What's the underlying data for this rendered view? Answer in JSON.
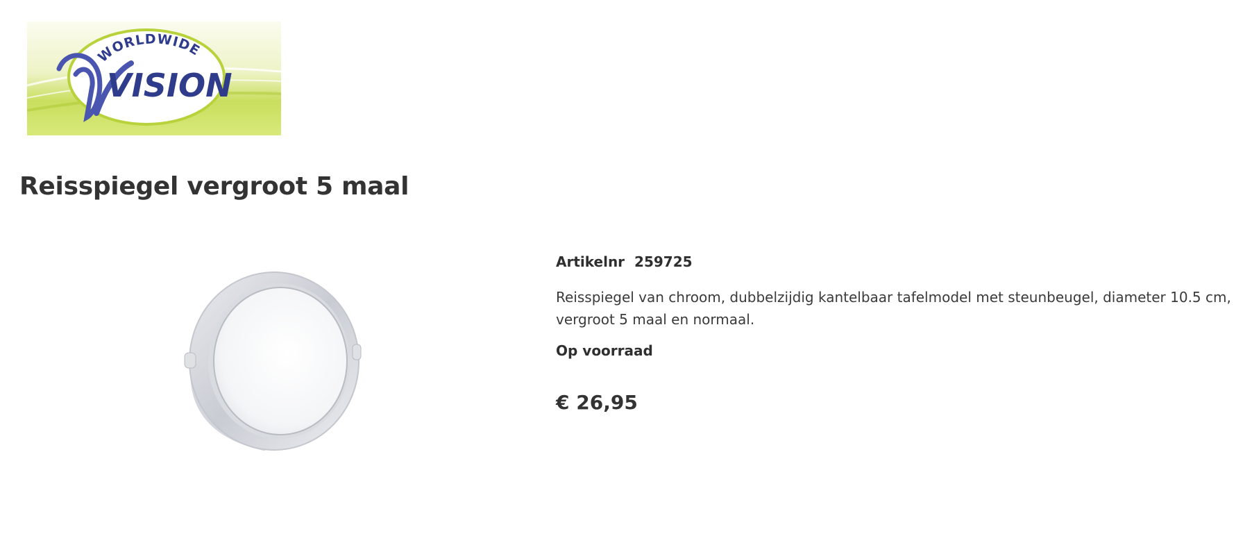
{
  "brand": {
    "logo_text_top": "WORLDWIDE",
    "logo_text_main": "VISION",
    "colors": {
      "navy": "#2f3c8c",
      "lime": "#b8d23c",
      "cream": "#f4f6dc"
    }
  },
  "product": {
    "title": "Reisspiegel vergroot 5 maal",
    "sku_label": "Artikelnr",
    "sku": "259725",
    "description": "Reisspiegel van chroom, dubbelzijdig kantelbaar tafelmodel met steunbeugel, diameter 10.5 cm, vergroot 5 maal en normaal.",
    "stock_status": "Op voorraad",
    "price": "€ 26,95",
    "image_icon": "round-mirror-image"
  }
}
